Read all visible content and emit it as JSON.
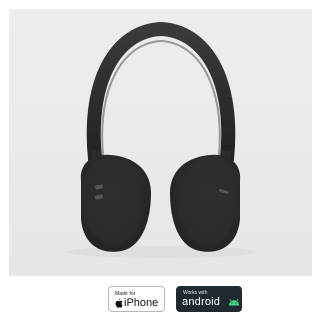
{
  "image": {
    "subject": "headphones-photo",
    "background_color": "#ebebeb",
    "product_color": "#2a2a2b"
  },
  "badges": {
    "iphone": {
      "small_text": "Made for",
      "big_text": "iPhone"
    },
    "android": {
      "small_text": "Works with",
      "big_text": "android",
      "accent_color": "#3ddc84"
    }
  }
}
